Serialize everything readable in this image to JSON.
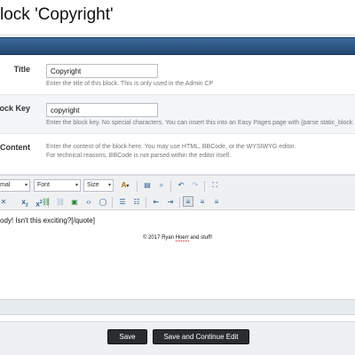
{
  "page": {
    "title": "lock 'Copyright'"
  },
  "fields": {
    "title": {
      "label": "Title",
      "value": "Copyright",
      "hint": "Enter the title of this block. This is only used in the Admin CP"
    },
    "key": {
      "label": "lock Key",
      "value": "copyright",
      "hint": "Enter the block key. No special characters. You can insert this into an Easy Pages page with {parse static_block"
    },
    "content": {
      "label": "Content",
      "hint1": "Enter the content of the block here. You may use HTML, BBCode, or the WYSIWYG editor.",
      "hint2": "For technical reasons, BBCode is not parsed within the editor itself."
    }
  },
  "toolbar": {
    "font_style": "mal",
    "font_family": "Font",
    "font_size": "Size",
    "text_color_glyph": "A",
    "subscript": "x",
    "superscript": "x"
  },
  "editor": {
    "line1": "ody! Isn't this exciting?[/quote]",
    "footer_prefix": "© 2017 Ryan ",
    "footer_squiggle": "Hoerr",
    "footer_suffix": " and stuff!"
  },
  "buttons": {
    "save": "Save",
    "save_continue": "Save and Continue Edit"
  },
  "colors": {
    "header": "#2d5683",
    "accent": "#2c5d91",
    "button": "#2a2d30"
  },
  "icons": [
    "select-all-icon",
    "find-icon",
    "replace-icon",
    "undo-icon",
    "redo-icon",
    "fullscreen-icon",
    "link-icon",
    "unlink-icon",
    "image-icon",
    "code-icon",
    "quote-icon",
    "bullet-list-icon",
    "numbered-list-icon",
    "outdent-icon",
    "indent-icon",
    "align-left-icon",
    "align-center-icon",
    "align-right-icon"
  ]
}
